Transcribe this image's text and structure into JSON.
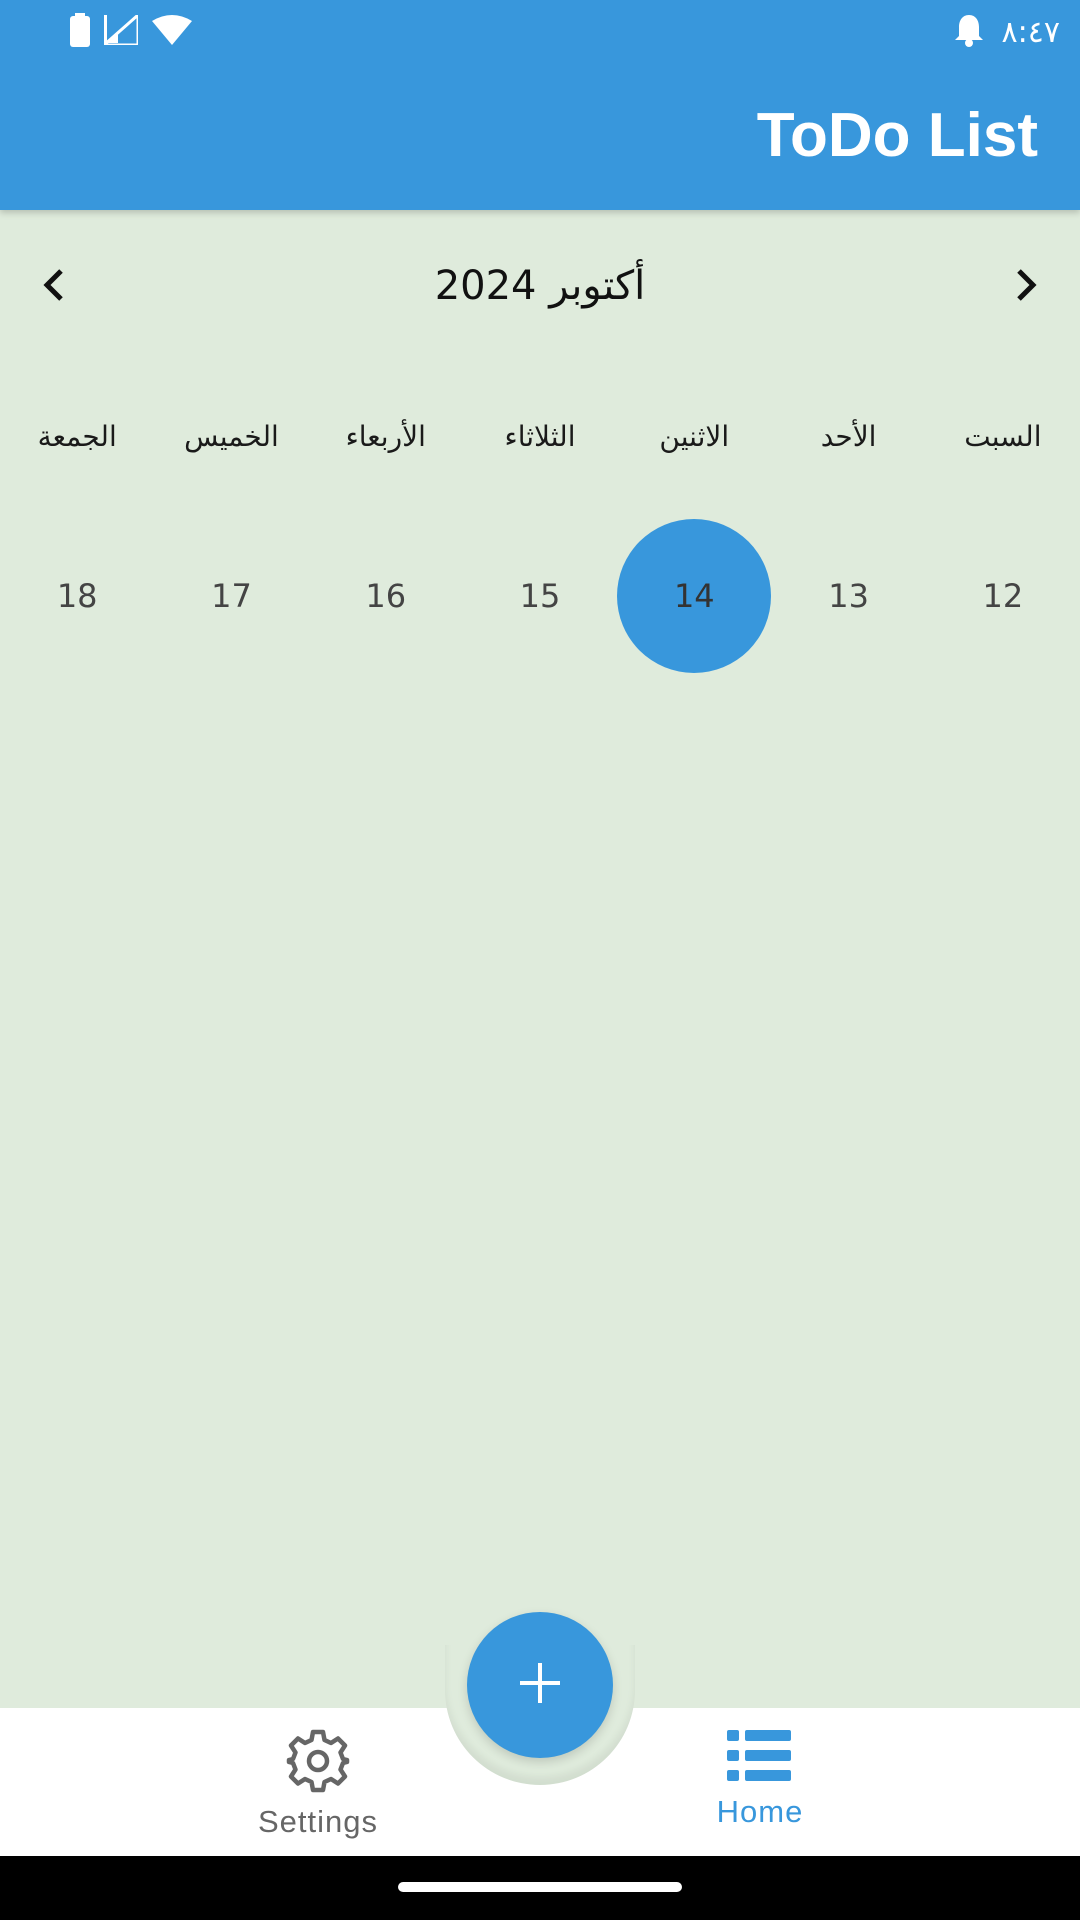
{
  "status_bar": {
    "time": "٨:٤٧",
    "icons": [
      "battery-icon",
      "signal-icon",
      "wifi-icon",
      "notification-bell-icon"
    ]
  },
  "app_bar": {
    "title": "ToDo List"
  },
  "calendar": {
    "month_title": "أكتوبر 2024",
    "prev_icon": "chevron-left-icon",
    "next_icon": "chevron-right-icon",
    "weekdays": [
      "السبت",
      "الأحد",
      "الاثنين",
      "الثلاثاء",
      "الأربعاء",
      "الخميس",
      "الجمعة"
    ],
    "days": [
      "12",
      "13",
      "14",
      "15",
      "16",
      "17",
      "18"
    ],
    "selected_day": "14"
  },
  "fab": {
    "icon": "plus-icon"
  },
  "bottom_nav": {
    "items": [
      {
        "label": "Settings",
        "icon": "gear-icon",
        "active": false
      },
      {
        "label": "Home",
        "icon": "list-icon",
        "active": true
      }
    ]
  },
  "colors": {
    "primary": "#3897dc",
    "background": "#dfebdc",
    "inactive": "#666666"
  }
}
